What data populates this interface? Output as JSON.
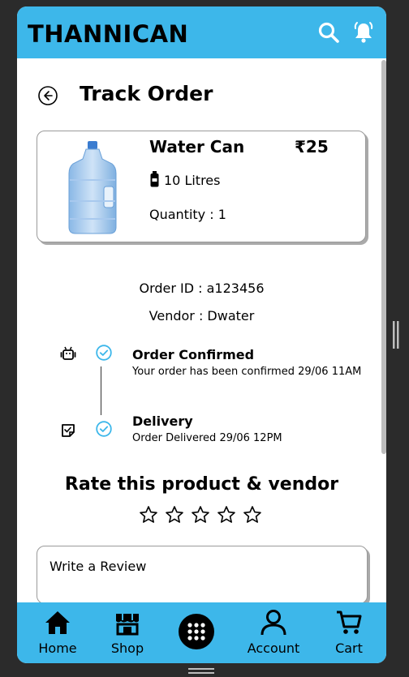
{
  "header": {
    "brand": "THANNICAN",
    "icons": [
      "search-icon",
      "bell-icon"
    ]
  },
  "page": {
    "title": "Track Order"
  },
  "product": {
    "name": "Water Can",
    "price": "₹25",
    "volume": "10 Litres",
    "quantity": "Quantity : 1"
  },
  "order": {
    "id": "Order ID : a123456",
    "vendor": "Vendor : Dwater"
  },
  "timeline": [
    {
      "title": "Order Confirmed",
      "desc": "Your order has been confirmed 29/06 11AM",
      "icon": "android-icon"
    },
    {
      "title": "Delivery",
      "desc": "Order Delivered 29/06 12PM",
      "icon": "note-check-icon"
    }
  ],
  "rating": {
    "title": "Rate this product & vendor",
    "max": 5,
    "value": 0
  },
  "review": {
    "placeholder": "Write a Review"
  },
  "nav": {
    "items": [
      {
        "label": "Home",
        "icon": "home-icon"
      },
      {
        "label": "Shop",
        "icon": "shop-icon"
      },
      {
        "label": "",
        "icon": "grid-menu-icon"
      },
      {
        "label": "Account",
        "icon": "account-icon"
      },
      {
        "label": "Cart",
        "icon": "cart-icon"
      }
    ]
  },
  "colors": {
    "accent": "#3db7ea",
    "check": "#3db7ea"
  }
}
